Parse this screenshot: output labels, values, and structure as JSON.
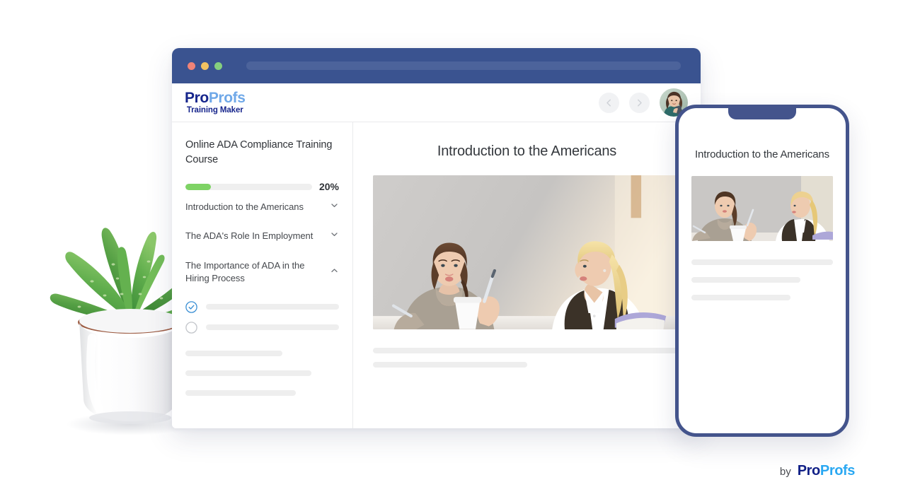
{
  "browser": {
    "traffic_lights": [
      "close-red",
      "minimize-yellow",
      "maximize-green"
    ],
    "url_pill": ""
  },
  "app_header": {
    "logo": {
      "pro": "Pro",
      "profs": "Profs",
      "tagline": "Training Maker"
    },
    "prev_button_icon": "chevron-left-icon",
    "next_button_icon": "chevron-right-icon",
    "avatar_alt": "user-avatar"
  },
  "sidebar": {
    "course_title": "Online ADA Compliance Training Course",
    "progress": {
      "percent_label": "20%",
      "percent_value": 20,
      "fill_color": "#7ed365",
      "track_color": "#efefef"
    },
    "modules": [
      {
        "label": "Introduction to the Americans",
        "expanded": false,
        "icon": "chevron-down-icon"
      },
      {
        "label": "The ADA's Role In Employment",
        "expanded": false,
        "icon": "chevron-down-icon"
      },
      {
        "label": "The Importance of ADA in the Hiring Process",
        "expanded": true,
        "icon": "chevron-up-icon"
      }
    ],
    "lessons": [
      {
        "status": "completed",
        "icon": "check-circle-icon",
        "bar_width": "100%"
      },
      {
        "status": "not-started",
        "icon": "empty-circle-icon",
        "bar_width": "100%"
      }
    ],
    "placeholder_bars": [
      "63%",
      "82%",
      "72%"
    ]
  },
  "main": {
    "lesson_title": "Introduction to the Americans",
    "hero_image_alt": "two-women-meeting-at-table",
    "placeholder_bars": [
      "100%",
      "50%"
    ]
  },
  "phone": {
    "lesson_title": "Introduction to the Americans",
    "hero_image_alt": "two-women-meeting-at-table",
    "placeholder_bars": [
      "100%",
      "77%",
      "70%"
    ],
    "frame_color": "#44548c"
  },
  "footer": {
    "by_label": "by",
    "brand_pro": "Pro",
    "brand_profs": "Profs"
  },
  "decor": {
    "plant_alt": "potted-aloe-plant"
  },
  "colors": {
    "titlebar": "#3a5390",
    "accent_green": "#7ed365",
    "accent_blue": "#3a8fd4",
    "brand_navy": "#16258c",
    "brand_light_blue": "#6fa8e8"
  }
}
